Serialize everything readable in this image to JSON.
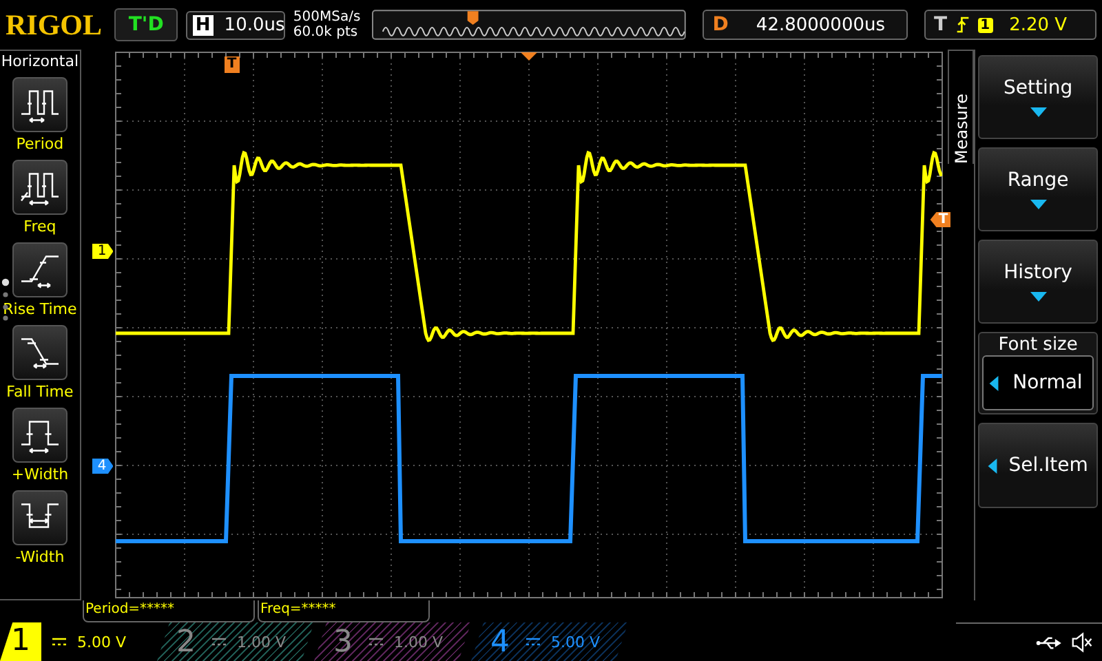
{
  "brand": "RIGOL",
  "run_status": "T'D",
  "horizontal": {
    "label": "H",
    "timebase": "10.0us",
    "sample_rate": "500MSa/s",
    "memory_depth": "60.0k pts"
  },
  "delay": {
    "label": "D",
    "value": "42.8000000us"
  },
  "trigger": {
    "label": "T",
    "source": "1",
    "level": "2.20 V"
  },
  "left_menu": {
    "title": "Horizontal",
    "items": [
      {
        "label": "Period",
        "kind": "period"
      },
      {
        "label": "Freq",
        "kind": "freq"
      },
      {
        "label": "Rise Time",
        "kind": "rise"
      },
      {
        "label": "Fall Time",
        "kind": "fall"
      },
      {
        "label": "+Width",
        "kind": "pwidth"
      },
      {
        "label": "-Width",
        "kind": "nwidth"
      }
    ]
  },
  "screen_markers": {
    "channel_1": "1",
    "channel_4": "4",
    "trigger_position": "T",
    "trigger_level": "T"
  },
  "right_menu": {
    "title": "Measure",
    "items": [
      {
        "kind": "dropdown",
        "label": "Setting"
      },
      {
        "kind": "dropdown",
        "label": "Range"
      },
      {
        "kind": "dropdown",
        "label": "History"
      },
      {
        "kind": "choice",
        "label": "Font size",
        "value": "Normal"
      },
      {
        "kind": "action",
        "label": "Sel.Item"
      }
    ]
  },
  "measurements": [
    "Period=*****",
    "Freq=*****"
  ],
  "channels": [
    {
      "number": "1",
      "scale": "5.00 V",
      "on": true,
      "selected": true,
      "color": "#ffff00"
    },
    {
      "number": "2",
      "scale": "1.00 V",
      "on": false,
      "selected": false,
      "color": "#1f5a52"
    },
    {
      "number": "3",
      "scale": "1.00 V",
      "on": false,
      "selected": false,
      "color": "#5a2458"
    },
    {
      "number": "4",
      "scale": "5.00 V",
      "on": true,
      "selected": false,
      "color": "#1e90ff"
    }
  ]
}
